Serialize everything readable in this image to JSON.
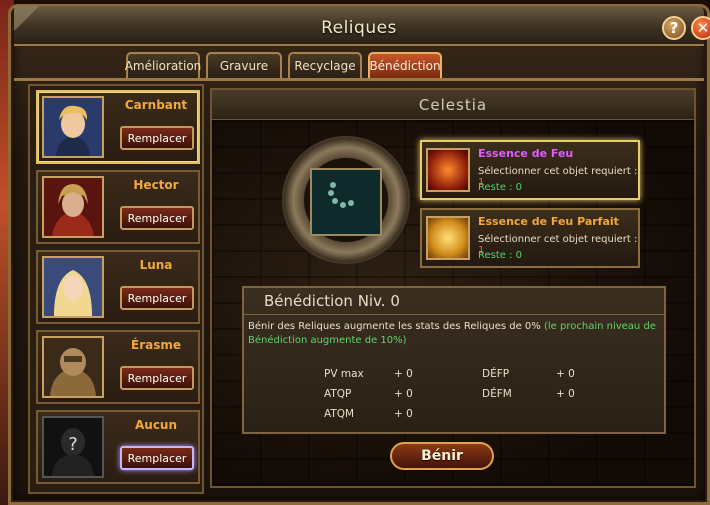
{
  "window": {
    "title": "Reliques"
  },
  "tabs": [
    {
      "label": "Amélioration"
    },
    {
      "label": "Gravure"
    },
    {
      "label": "Recyclage"
    },
    {
      "label": "Bénédiction",
      "active": true
    }
  ],
  "heroes": [
    {
      "name": "Carnbant",
      "button": "Remplacer",
      "selected": true
    },
    {
      "name": "Hector",
      "button": "Remplacer"
    },
    {
      "name": "Luna",
      "button": "Remplacer"
    },
    {
      "name": "Érasme",
      "button": "Remplacer"
    },
    {
      "name": "Aucun",
      "button": "Remplacer",
      "placeholder": "?"
    }
  ],
  "main": {
    "title": "Celestia",
    "essences": [
      {
        "name": "Essence de Feu",
        "name_color": "#e25cff",
        "requirement": "Sélectionner cet objet requiert :",
        "req_count": "1",
        "stock": "Reste : 0"
      },
      {
        "name": "Essence de Feu Parfait",
        "name_color": "#f2a83a",
        "requirement": "Sélectionner cet objet requiert :",
        "req_count": "1",
        "stock": "Reste : 0"
      }
    ],
    "benediction": {
      "title": "Bénédiction Niv. 0",
      "desc": "Bénir des Reliques augmente les stats des Reliques de 0%",
      "desc_hint": "(le prochain niveau de Bénédiction augmente de 10%)",
      "stats": [
        {
          "label": "PV max",
          "value": "+ 0"
        },
        {
          "label": "ATQP",
          "value": "+ 0"
        },
        {
          "label": "ATQM",
          "value": "+ 0"
        },
        {
          "label": "DÉFP",
          "value": "+ 0"
        },
        {
          "label": "DÉFM",
          "value": "+ 0"
        }
      ]
    },
    "bless_button": "Bénir"
  }
}
